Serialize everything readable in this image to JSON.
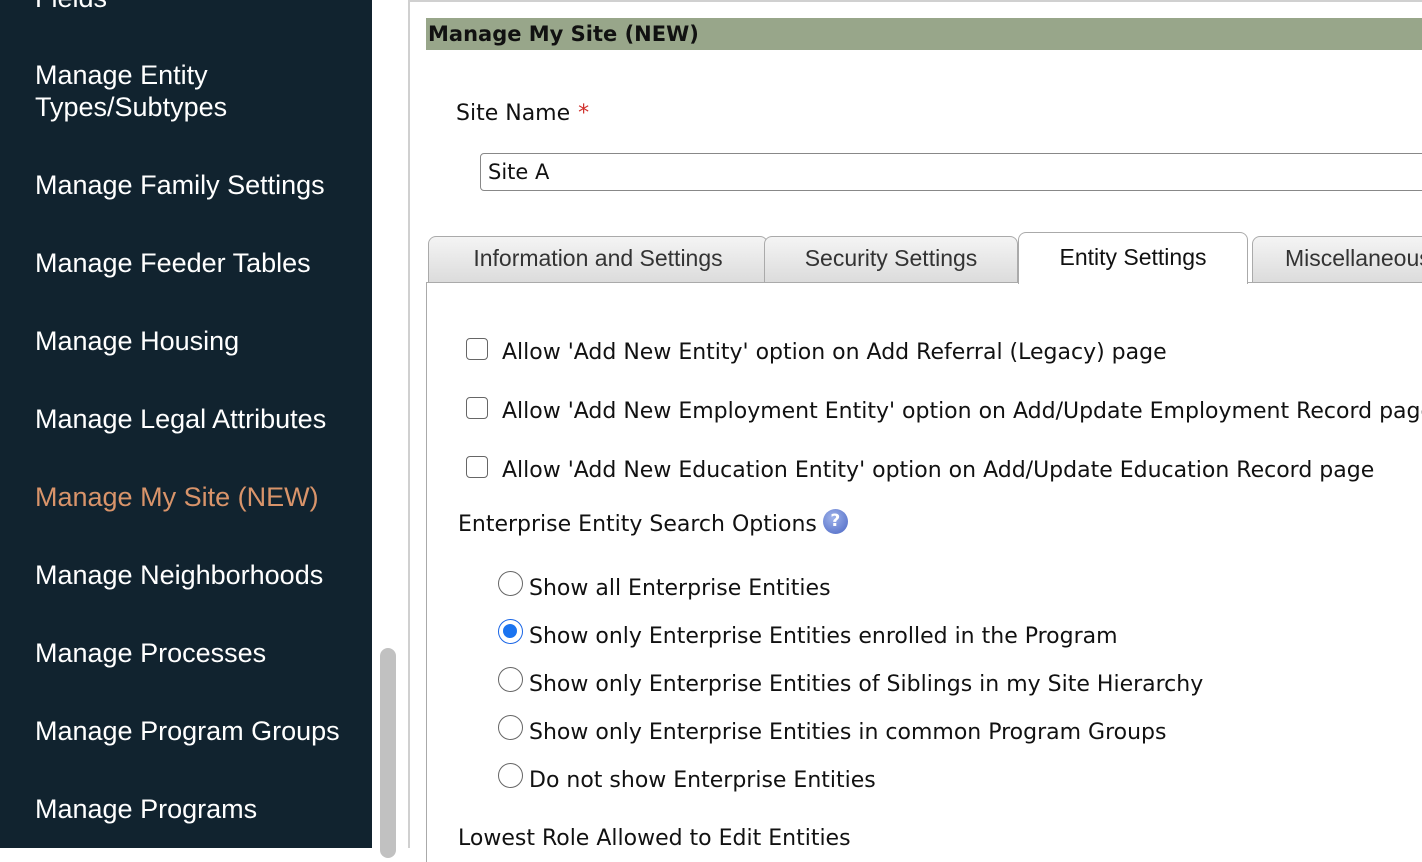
{
  "sidebar": {
    "items": [
      {
        "label": "Fields"
      },
      {
        "label": "Manage Entity Types/Subtypes"
      },
      {
        "label": "Manage Family Settings"
      },
      {
        "label": "Manage Feeder Tables"
      },
      {
        "label": "Manage Housing"
      },
      {
        "label": "Manage Legal Attributes"
      },
      {
        "label": "Manage My Site (NEW)"
      },
      {
        "label": "Manage Neighborhoods"
      },
      {
        "label": "Manage Processes"
      },
      {
        "label": "Manage Program Groups"
      },
      {
        "label": "Manage Programs"
      }
    ],
    "active_color": "#d9946a",
    "background": "#11232f"
  },
  "header": {
    "title": "Manage My Site (NEW)",
    "color": "#98a68a"
  },
  "form": {
    "site_name_label": "Site Name",
    "required_marker": "*",
    "site_name_value": "Site A"
  },
  "tabs": [
    {
      "label": "Information and Settings"
    },
    {
      "label": "Security Settings"
    },
    {
      "label": "Entity Settings",
      "active": true
    },
    {
      "label": "Miscellaneous"
    }
  ],
  "entity_settings": {
    "checkboxes": [
      {
        "label": "Allow 'Add New Entity' option on Add Referral (Legacy) page",
        "checked": false
      },
      {
        "label": "Allow 'Add New Employment Entity' option on Add/Update Employment Record page",
        "checked": false
      },
      {
        "label": "Allow 'Add New Education Entity' option on Add/Update Education Record page",
        "checked": false
      }
    ],
    "search_options_label": "Enterprise Entity Search Options",
    "help_icon": "question-circle-icon",
    "radio_options": [
      {
        "label": "Show all Enterprise Entities",
        "checked": false
      },
      {
        "label": "Show only Enterprise Entities enrolled in the Program",
        "checked": true
      },
      {
        "label": "Show only Enterprise Entities of Siblings in my Site Hierarchy",
        "checked": false
      },
      {
        "label": "Show only Enterprise Entities in common Program Groups",
        "checked": false
      },
      {
        "label": "Do not show Enterprise Entities",
        "checked": false
      }
    ],
    "lowest_role_label": "Lowest Role Allowed to Edit Entities"
  }
}
